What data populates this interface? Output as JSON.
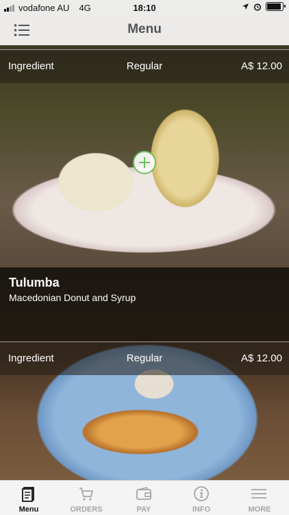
{
  "status_bar": {
    "carrier": "vodafone AU",
    "network": "4G",
    "time": "18:10"
  },
  "nav": {
    "title": "Menu",
    "menu_icon": "list-icon"
  },
  "dishes": [
    {
      "name": "",
      "description": "",
      "ingredient_label": "Ingredient",
      "size_label": "Regular",
      "price": "A$ 12.00"
    },
    {
      "name": "Tulumba",
      "description": "Macedonian Donut and Syrup",
      "ingredient_label": "Ingredient",
      "size_label": "Regular",
      "price": "A$ 12.00"
    }
  ],
  "tabs": [
    {
      "label": "Menu",
      "icon": "menu-book-icon",
      "active": true
    },
    {
      "label": "ORDERS",
      "icon": "cart-icon",
      "active": false
    },
    {
      "label": "PAY",
      "icon": "wallet-icon",
      "active": false
    },
    {
      "label": "INFO",
      "icon": "info-icon",
      "active": false
    },
    {
      "label": "MORE",
      "icon": "more-lines-icon",
      "active": false
    }
  ],
  "colors": {
    "accent_green": "#6cc35e",
    "tab_inactive": "#a4a4a4",
    "tab_active": "#111111"
  }
}
